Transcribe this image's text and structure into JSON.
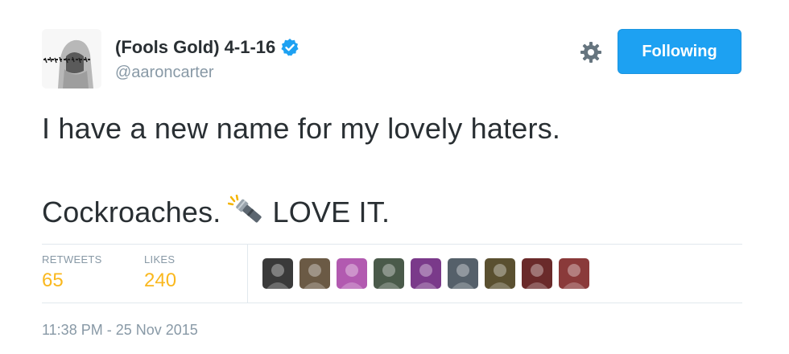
{
  "header": {
    "display_name": "(Fools Gold) 4-1-16",
    "handle": "@aaroncarter",
    "follow_label": "Following",
    "verified": true,
    "settings_icon": "gear-icon",
    "avatar_icon": "profile-avatar-icon"
  },
  "tweet": {
    "line1": "I have a new name for my lovely haters.",
    "line2_before": "Cockroaches.",
    "line2_emoji": "flashlight-icon",
    "line2_after": "LOVE IT."
  },
  "stats": {
    "retweets_label": "RETWEETS",
    "retweets_value": "65",
    "likes_label": "LIKES",
    "likes_value": "240"
  },
  "likers": [
    {
      "name": "liker-avatar-1",
      "color": "#3a3a3a"
    },
    {
      "name": "liker-avatar-2",
      "color": "#6b5a45"
    },
    {
      "name": "liker-avatar-3",
      "color": "#b25ab0"
    },
    {
      "name": "liker-avatar-4",
      "color": "#4a5a4a"
    },
    {
      "name": "liker-avatar-5",
      "color": "#7a3a8a"
    },
    {
      "name": "liker-avatar-6",
      "color": "#55606a"
    },
    {
      "name": "liker-avatar-7",
      "color": "#5a5030"
    },
    {
      "name": "liker-avatar-8",
      "color": "#6a2a2a"
    },
    {
      "name": "liker-avatar-9",
      "color": "#8a3a3a"
    }
  ],
  "timestamp": "11:38 PM - 25 Nov 2015",
  "colors": {
    "accent": "#1da1f2",
    "count": "#fab81e",
    "muted": "#8899a6",
    "text": "#292f33"
  }
}
